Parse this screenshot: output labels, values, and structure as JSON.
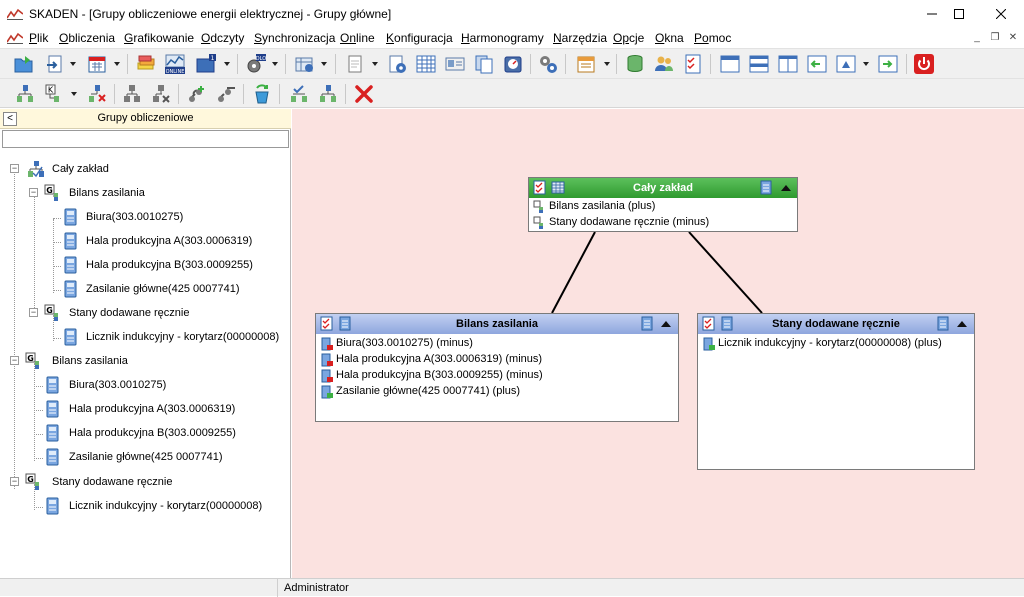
{
  "window": {
    "title": "SKADEN - [Grupy obliczeniowe energii elektrycznej - Grupy główne]",
    "minimize": "─",
    "maximize": "☐",
    "close": "✕"
  },
  "menu": {
    "items": [
      {
        "u": "P",
        "rest": "lik"
      },
      {
        "u": "O",
        "rest": "bliczenia"
      },
      {
        "u": "G",
        "rest": "rafikowanie"
      },
      {
        "u": "O",
        "rest": "dczyty"
      },
      {
        "u": "S",
        "rest": "ynchronizacja"
      },
      {
        "u": "On",
        "rest": "line"
      },
      {
        "u": "K",
        "rest": "onfiguracja"
      },
      {
        "u": "H",
        "rest": "armonogramy"
      },
      {
        "u": "N",
        "rest": "arzędzia"
      },
      {
        "u": "Op",
        "rest": "cje"
      },
      {
        "u": "O",
        "rest": "kna"
      },
      {
        "u": "Po",
        "rest": "moc"
      }
    ],
    "mdi_minimize": "_",
    "mdi_restore": "❐",
    "mdi_close": "✕"
  },
  "toolbar": {
    "online_badge": "ONLINE",
    "dlo_badge": "DLO"
  },
  "left_panel": {
    "collapse_label": "<",
    "title": "Grupy obliczeniowe",
    "search_value": "",
    "tree": [
      {
        "label": "Cały zakład",
        "kind": "group-root",
        "expander": "−"
      },
      {
        "label": "Bilans zasilania",
        "kind": "group",
        "expander": "−"
      },
      {
        "label": "Biura(303.0010275)",
        "kind": "meter"
      },
      {
        "label": "Hala produkcyjna A(303.0006319)",
        "kind": "meter"
      },
      {
        "label": "Hala produkcyjna B(303.0009255)",
        "kind": "meter"
      },
      {
        "label": "Zasilanie główne(425 0007741)",
        "kind": "meter"
      },
      {
        "label": "Stany dodawane ręcznie",
        "kind": "group",
        "expander": "−"
      },
      {
        "label": "Licznik indukcyjny - korytarz(00000008)",
        "kind": "meter"
      },
      {
        "label": "Bilans zasilania",
        "kind": "group",
        "expander": "−"
      },
      {
        "label": "Biura(303.0010275)",
        "kind": "meter"
      },
      {
        "label": "Hala produkcyjna A(303.0006319)",
        "kind": "meter"
      },
      {
        "label": "Hala produkcyjna B(303.0009255)",
        "kind": "meter"
      },
      {
        "label": "Zasilanie główne(425 0007741)",
        "kind": "meter"
      },
      {
        "label": "Stany dodawane ręcznie",
        "kind": "group",
        "expander": "−"
      },
      {
        "label": "Licznik indukcyjny - korytarz(00000008)",
        "kind": "meter"
      }
    ]
  },
  "diagram": {
    "root": {
      "title": "Cały zakład",
      "rows": [
        "Bilans zasilania (plus)",
        "Stany dodawane ręcznie (minus)"
      ]
    },
    "left": {
      "title": "Bilans zasilania",
      "rows": [
        "Biura(303.0010275) (minus)",
        "Hala produkcyjna A(303.0006319) (minus)",
        "Hala produkcyjna B(303.0009255) (minus)",
        "Zasilanie główne(425 0007741) (plus)"
      ]
    },
    "right": {
      "title": "Stany dodawane ręcznie",
      "rows": [
        "Licznik indukcyjny - korytarz(00000008) (plus)"
      ]
    }
  },
  "status": {
    "user": "Administrator"
  },
  "colors": {
    "canvas_bg": "#fbe2e0",
    "root_header": "#3ca33c",
    "child_header": "#9fb4e6",
    "panel_header": "#fff8dc",
    "accent_red": "#d92020"
  }
}
